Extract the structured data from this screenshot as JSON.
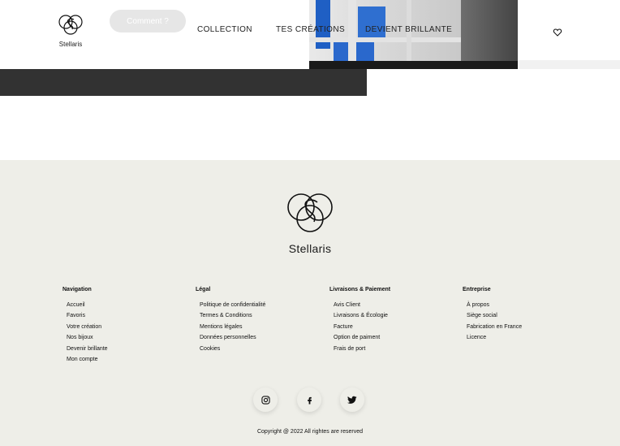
{
  "header": {
    "brand": "Stellaris",
    "cta_label": "Comment ?",
    "nav": [
      "COLLECTION",
      "TES CRÉATIONS",
      "DEVIENT BRILLANTE"
    ],
    "favorites_icon": "heart-icon"
  },
  "footer": {
    "brand": "Stellaris",
    "columns": [
      {
        "title": "Navigation",
        "items": [
          "Accueil",
          "Favoris",
          "Votre création",
          "Nos bijoux",
          "Devenir brillante",
          "Mon compte"
        ]
      },
      {
        "title": "Légal",
        "items": [
          "Politique de confidentialité",
          "Termes & Conditions",
          "Mentions légales",
          "Données personnelles",
          "Cookies"
        ]
      },
      {
        "title": "Livraisons & Paiement",
        "items": [
          "Avis Client",
          "Livraisons & Écologie",
          "Facture",
          "Option de paiment",
          "Frais de port"
        ]
      },
      {
        "title": "Entreprise",
        "items": [
          "À propos",
          "Siège social",
          "Fabrication en France",
          "Licence"
        ]
      }
    ],
    "social": [
      "instagram-icon",
      "facebook-icon",
      "twitter-icon"
    ],
    "copyright": "Copyright @ 2022 All rightes are reserved"
  },
  "colors": {
    "footer_bg": "#eeeee8",
    "dark_bar": "#323232",
    "cta_bg": "#e6e6e6"
  }
}
